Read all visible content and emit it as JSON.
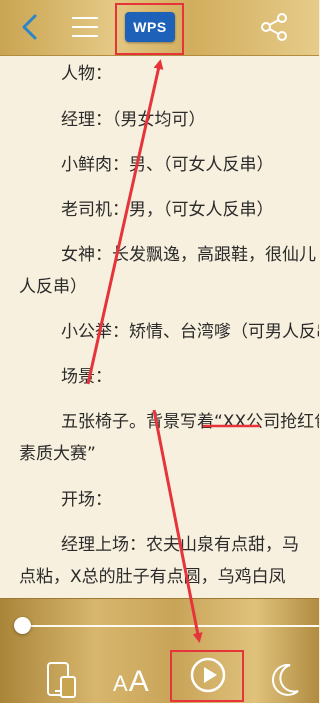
{
  "toolbar": {
    "back_icon": "chevron-left-icon",
    "menu_icon": "hamburger-menu-icon",
    "wps_label": "WPS",
    "share_icon": "share-icon"
  },
  "document": {
    "lines": [
      "人物：",
      "经理：（男女均可）",
      "小鲜肉：男、（可女人反串）",
      "老司机：男，（可女人反串）",
      "女神：长发飘逸，高跟鞋，很仙儿",
      "人反串）",
      "小公举：矫情、台湾嗲（可男人反串",
      "场景：",
      "五张椅子。背景写着“XX公司抢红包",
      "素质大赛”",
      "开场：",
      "经理上场：农夫山泉有点甜，马",
      "点粘，X总的肚子有点圆，乌鸡白凤"
    ]
  },
  "bottom": {
    "progress": 0.0,
    "font_label": "AA",
    "device_icon": "phone-tablet-icon",
    "play_icon": "play-icon",
    "night_icon": "moon-icon"
  },
  "colors": {
    "annotation": "#e5343a",
    "wps_blue": "#1d62b8"
  }
}
